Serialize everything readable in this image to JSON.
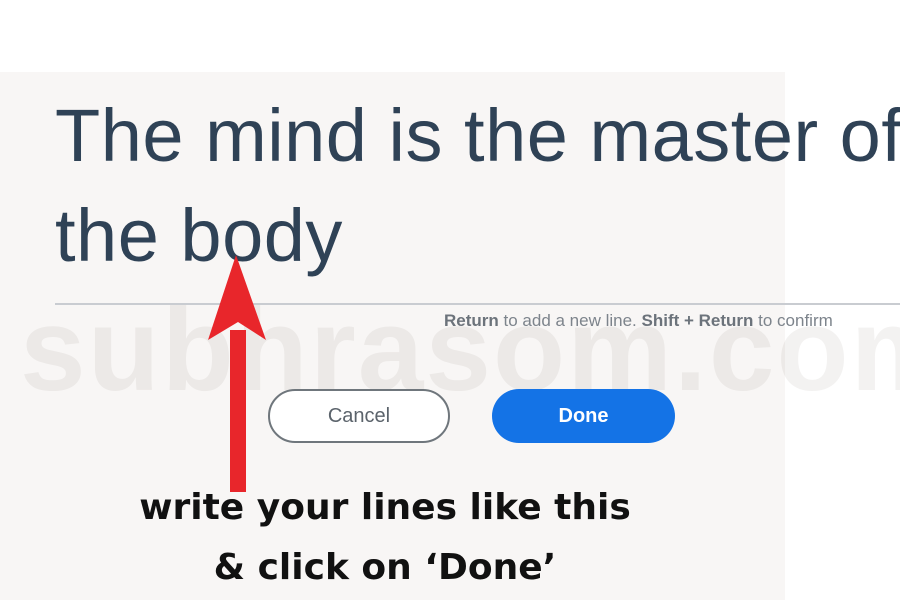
{
  "editor": {
    "lines": [
      "The mind is the master of",
      "the body"
    ]
  },
  "hint": {
    "key1": "Return",
    "text1": " to add a new line. ",
    "key2": "Shift + Return",
    "text2": " to confirm"
  },
  "buttons": {
    "cancel_label": "Cancel",
    "done_label": "Done"
  },
  "watermark": "subhrasom.com",
  "annotation": {
    "line1": "write your lines like this",
    "line2": "& click on ‘Done’"
  },
  "colors": {
    "text": "#2f4256",
    "primary_button": "#1473e6",
    "arrow": "#e8262b"
  }
}
